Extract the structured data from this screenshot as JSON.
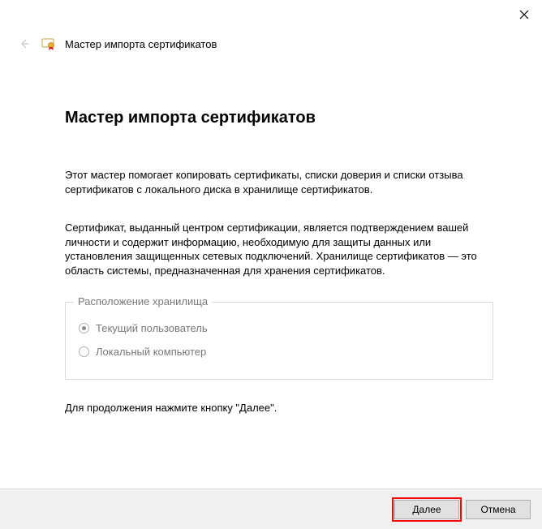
{
  "header": {
    "title": "Мастер импорта сертификатов"
  },
  "main": {
    "title": "Мастер импорта сертификатов",
    "para1": "Этот мастер помогает копировать сертификаты, списки доверия и списки отзыва сертификатов с локального диска в хранилище сертификатов.",
    "para2": "Сертификат, выданный центром сертификации, является подтверждением вашей личности и содержит информацию, необходимую для защиты данных или установления защищенных сетевых подключений. Хранилище сертификатов — это область системы, предназначенная для хранения сертификатов.",
    "groupbox": {
      "legend": "Расположение хранилища",
      "option1": "Текущий пользователь",
      "option2": "Локальный компьютер"
    },
    "continue_hint": "Для продолжения нажмите кнопку \"Далее\"."
  },
  "footer": {
    "next": "Далее",
    "cancel": "Отмена"
  }
}
